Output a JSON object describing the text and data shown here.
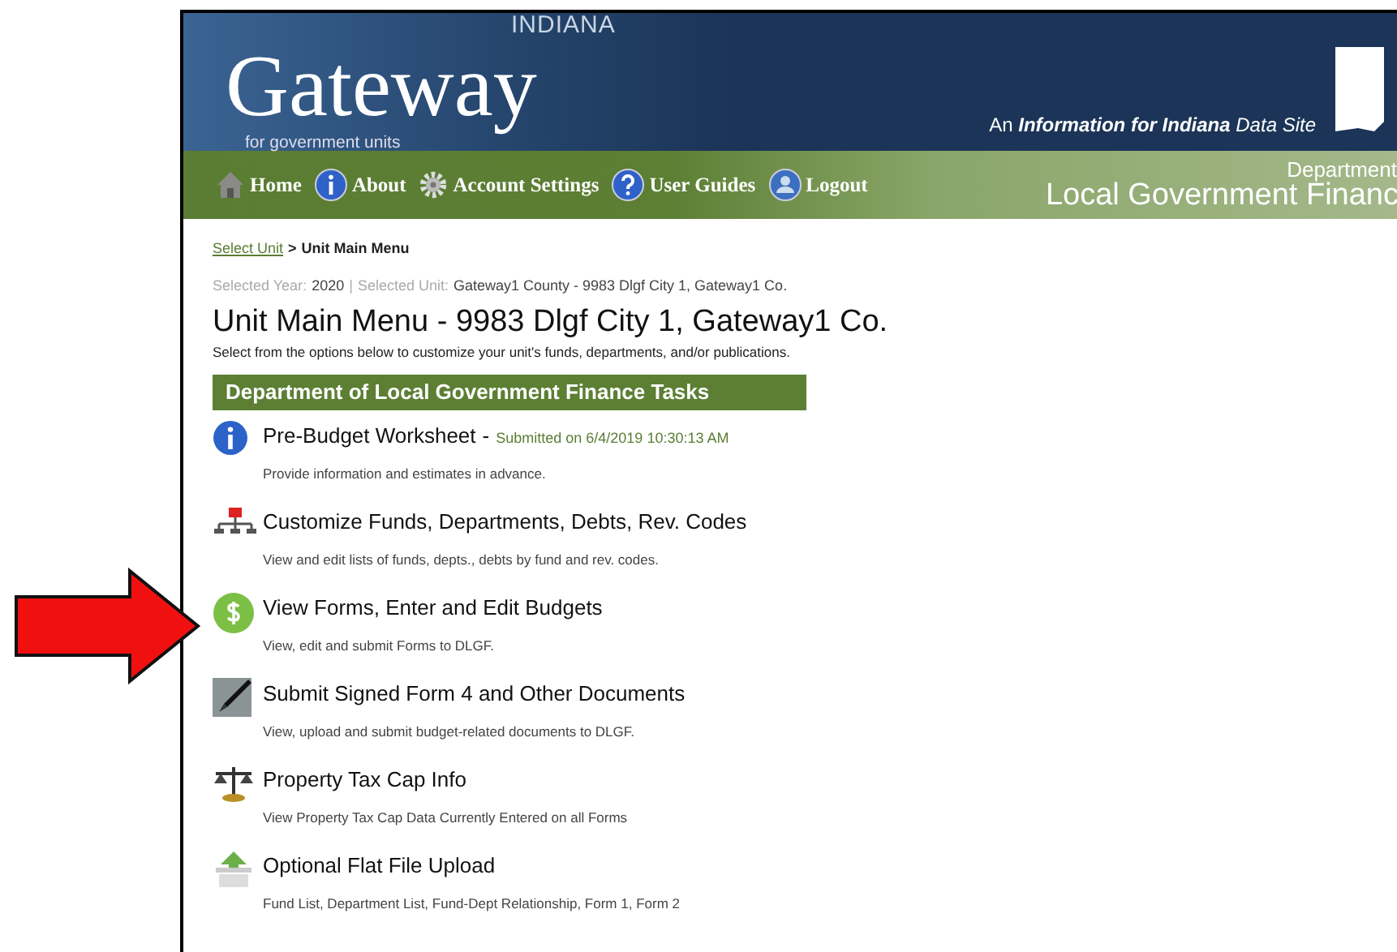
{
  "header": {
    "logo_state": "INDIANA",
    "logo_name": "Gateway",
    "logo_sub": "for government units",
    "tagline": "An **Information for Indiana** *Data Site*"
  },
  "nav": {
    "items": [
      {
        "kind": "home",
        "label": "Home"
      },
      {
        "kind": "about",
        "label": "About"
      },
      {
        "kind": "settings",
        "label": "Account Settings"
      },
      {
        "kind": "help",
        "label": "User Guides"
      },
      {
        "kind": "logout",
        "label": "Logout"
      }
    ],
    "dept_small": "Department",
    "dept_large": "Local Government Financ"
  },
  "breadcrumb": {
    "link": "Select Unit",
    "separator": ">",
    "current": "Unit Main Menu"
  },
  "selection": {
    "year_label": "Selected Year:",
    "year": "2020",
    "divider": "|",
    "unit_label": "Selected Unit:",
    "unit": "Gateway1 County - 9983 Dlgf City 1, Gateway1 Co."
  },
  "title": "Unit Main Menu - 9983 Dlgf City 1, Gateway1 Co.",
  "intro": "Select from the options below to customize your unit's funds, departments, and/or publications.",
  "section": "Department of Local Government Finance Tasks",
  "tasks": [
    {
      "kind": "info",
      "title": "Pre-Budget Worksheet",
      "status_separator": "-",
      "status": "Submitted on 6/4/2019 10:30:13 AM",
      "description": "Provide information and estimates in advance.",
      "pointed": false
    },
    {
      "kind": "org",
      "title": "Customize Funds, Departments, Debts, Rev. Codes",
      "description": "View and edit lists of funds, depts., debts by fund and rev. codes.",
      "pointed": false
    },
    {
      "kind": "dollar",
      "title": "View Forms, Enter and Edit Budgets",
      "description": "View, edit and submit Forms to DLGF.",
      "pointed": true
    },
    {
      "kind": "pen",
      "title": "Submit Signed Form 4 and Other Documents",
      "description": "View, upload and submit budget-related documents to DLGF.",
      "pointed": false
    },
    {
      "kind": "scale",
      "title": "Property Tax Cap Info",
      "description": "View Property Tax Cap Data Currently Entered on all Forms",
      "pointed": false
    },
    {
      "kind": "upload",
      "title": "Optional Flat File Upload",
      "description": "Fund List, Department List, Fund-Dept Relationship, Form 1, Form 2",
      "pointed": false
    }
  ]
}
